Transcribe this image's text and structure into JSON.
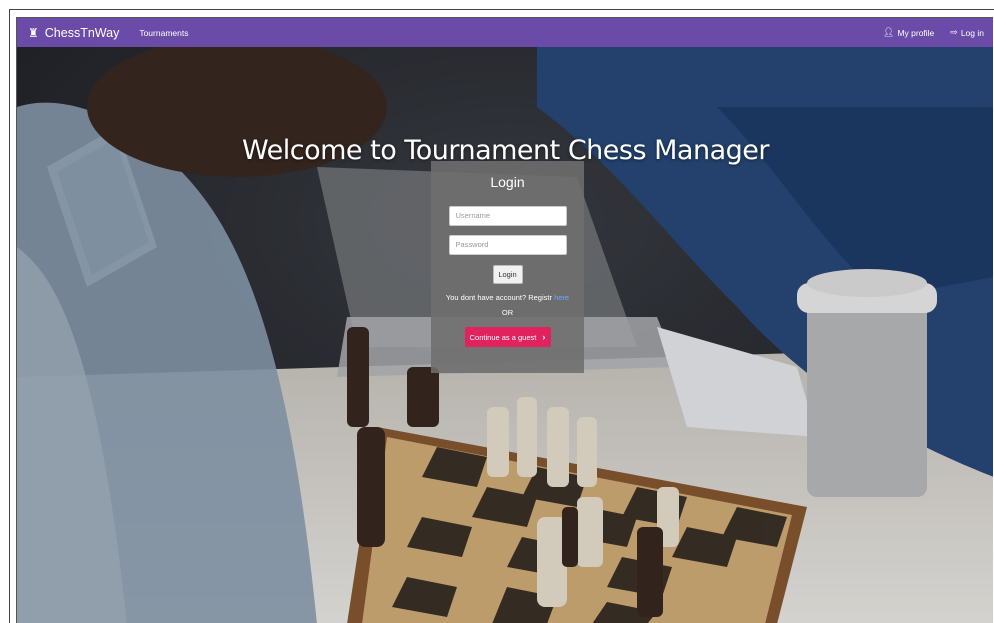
{
  "navbar": {
    "brand_icon": "chess-rook-icon",
    "brand": "ChessTnWay",
    "tournaments": "Tournaments",
    "my_profile": "My profile",
    "log_in": "Log in",
    "color": "#6a4ca8"
  },
  "hero": {
    "title": "Welcome to Tournament Chess Manager"
  },
  "login": {
    "title": "Login",
    "username_placeholder": "Username",
    "password_placeholder": "Password",
    "login_button": "Login",
    "account_text": "You dont have account? Registr",
    "register_link": "here",
    "or": "OR",
    "guest_button": "Continue as a guest",
    "guest_color": "#e0235f"
  }
}
